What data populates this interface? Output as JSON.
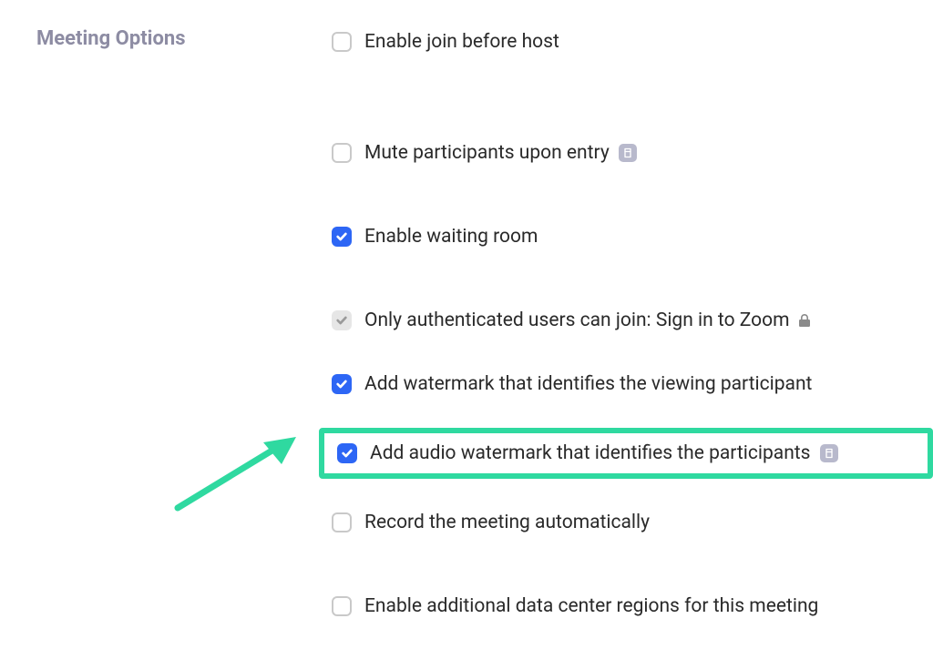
{
  "section": {
    "title": "Meeting Options"
  },
  "options": [
    {
      "label": "Enable join before host",
      "checked": false,
      "disabled": false,
      "info": false,
      "lock": false
    },
    {
      "label": "Mute participants upon entry",
      "checked": false,
      "disabled": false,
      "info": true,
      "lock": false
    },
    {
      "label": "Enable waiting room",
      "checked": true,
      "disabled": false,
      "info": false,
      "lock": false
    },
    {
      "label": "Only authenticated users can join: Sign in to Zoom",
      "checked": true,
      "disabled": true,
      "info": false,
      "lock": true
    },
    {
      "label": "Add watermark that identifies the viewing participant",
      "checked": true,
      "disabled": false,
      "info": false,
      "lock": false
    },
    {
      "label": "Add audio watermark that identifies the participants",
      "checked": true,
      "disabled": false,
      "info": true,
      "lock": false
    },
    {
      "label": "Record the meeting automatically",
      "checked": false,
      "disabled": false,
      "info": false,
      "lock": false
    },
    {
      "label": "Enable additional data center regions for this meeting",
      "checked": false,
      "disabled": false,
      "info": false,
      "lock": false
    }
  ],
  "icons": {
    "info_glyph": "⧉"
  },
  "highlight": {
    "color": "#2fd9a0"
  }
}
